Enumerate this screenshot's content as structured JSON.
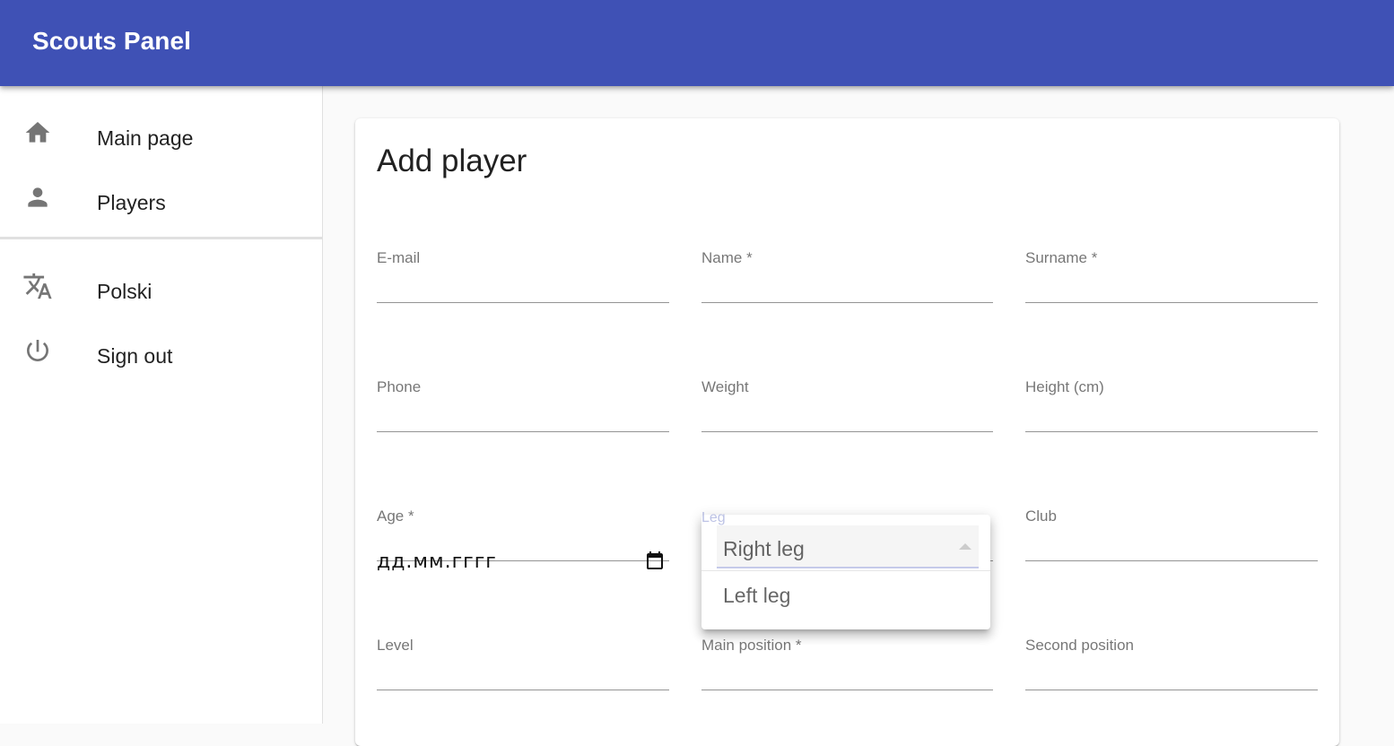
{
  "appbar": {
    "title": "Scouts Panel",
    "color": "#3f51b5"
  },
  "sidebar": {
    "items": [
      {
        "label": "Main page",
        "icon": "home-icon"
      },
      {
        "label": "Players",
        "icon": "person-icon"
      }
    ],
    "secondary_items": [
      {
        "label": "Polski",
        "icon": "translate-icon"
      },
      {
        "label": "Sign out",
        "icon": "power-icon"
      }
    ]
  },
  "form": {
    "title": "Add player",
    "fields": {
      "email": {
        "label": "E-mail",
        "value": ""
      },
      "name": {
        "label": "Name *",
        "value": ""
      },
      "surname": {
        "label": "Surname *",
        "value": ""
      },
      "phone": {
        "label": "Phone",
        "value": ""
      },
      "weight": {
        "label": "Weight",
        "value": ""
      },
      "height": {
        "label": "Height (cm)",
        "value": ""
      },
      "age": {
        "label": "Age *",
        "value": "дд.мм.гггг"
      },
      "leg": {
        "label": "Leg",
        "options": [
          "Right leg",
          "Left leg"
        ],
        "selected": "Right leg"
      },
      "club": {
        "label": "Club",
        "value": ""
      },
      "level": {
        "label": "Level",
        "value": ""
      },
      "main_position": {
        "label": "Main position *",
        "value": ""
      },
      "second_position": {
        "label": "Second position",
        "value": ""
      }
    }
  }
}
